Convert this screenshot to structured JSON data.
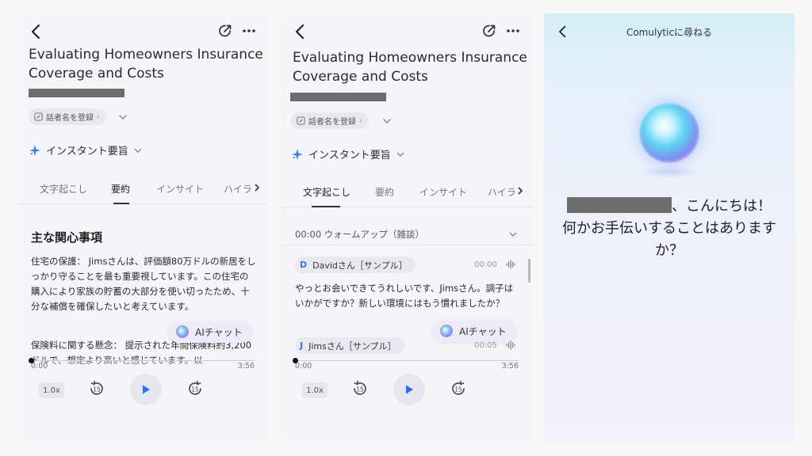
{
  "screen1": {
    "title": "Evaluating Homeowners Insurance Coverage and Costs",
    "speaker_chip": "話者名を登録",
    "instant_summary": "インスタント要旨",
    "tabs": [
      "文字起こし",
      "要約",
      "インサイト",
      "ハイラ"
    ],
    "active_tab": "要約",
    "section_heading": "主な関心事項",
    "paragraph1": "住宅の保護： Jimsさんは、評価額80万ドルの新居をしっかり守ることを最も重要視しています。この住宅の購入により家族の貯蓄の大部分を使い切ったため、十分な補償を確保したいと考えています。",
    "paragraph2": "保険料に関する懸念： 提示された年間保険料約3,200ドルで、想定より高いと感じています。以",
    "ai_chat": "AIチャット",
    "time_start": "0:00",
    "time_end": "3:56",
    "speed": "1.0x",
    "skip_back": "15",
    "skip_fwd": "15"
  },
  "screen2": {
    "title": "Evaluating Homeowners Insurance Coverage and Costs",
    "speaker_chip": "話者名を登録",
    "instant_summary": "インスタント要旨",
    "tabs": [
      "文字起こし",
      "要約",
      "インサイト",
      "ハイラ"
    ],
    "active_tab": "文字起こし",
    "section": "00:00 ウォームアップ（雑談）",
    "speaker1_initial": "D",
    "speaker1_name": "Davidさん［サンプル］",
    "speaker1_time": "00:00",
    "speaker1_text": "やっとお会いできてうれしいです、Jimsさん。調子はいかがですか？新しい環境にはもう慣れましたか？",
    "speaker2_initial": "J",
    "speaker2_name": "Jimsさん［サンプル］",
    "speaker2_time": "00:05",
    "ai_chat": "AIチャット",
    "time_start": "0:00",
    "time_end": "3:56",
    "speed": "1.0x",
    "skip_back": "15",
    "skip_fwd": "15"
  },
  "screen3": {
    "title": "Comulyticに尋ねる",
    "greeting_line1_suffix": "、こんにちは！",
    "greeting_rest": "何かお手伝いすることはありますか？"
  },
  "colors": {
    "accent_blue": "#2f6fe8",
    "redaction": "#6d6d6d"
  },
  "icons": [
    "back-icon",
    "edit-icon",
    "more-icon",
    "pencil-icon",
    "chevron-down-icon",
    "sparkle-icon",
    "chevron-right-icon",
    "skip-back-15-icon",
    "play-icon",
    "skip-forward-15-icon",
    "waveform-icon",
    "ai-orb-icon"
  ]
}
